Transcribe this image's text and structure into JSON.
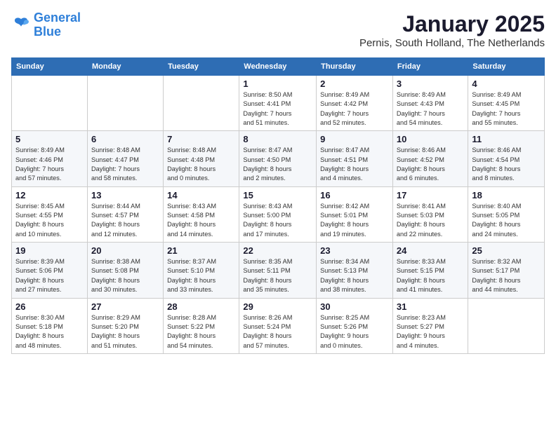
{
  "header": {
    "logo_line1": "General",
    "logo_line2": "Blue",
    "title": "January 2025",
    "subtitle": "Pernis, South Holland, The Netherlands"
  },
  "columns": [
    "Sunday",
    "Monday",
    "Tuesday",
    "Wednesday",
    "Thursday",
    "Friday",
    "Saturday"
  ],
  "weeks": [
    [
      {
        "day": "",
        "info": ""
      },
      {
        "day": "",
        "info": ""
      },
      {
        "day": "",
        "info": ""
      },
      {
        "day": "1",
        "info": "Sunrise: 8:50 AM\nSunset: 4:41 PM\nDaylight: 7 hours\nand 51 minutes."
      },
      {
        "day": "2",
        "info": "Sunrise: 8:49 AM\nSunset: 4:42 PM\nDaylight: 7 hours\nand 52 minutes."
      },
      {
        "day": "3",
        "info": "Sunrise: 8:49 AM\nSunset: 4:43 PM\nDaylight: 7 hours\nand 54 minutes."
      },
      {
        "day": "4",
        "info": "Sunrise: 8:49 AM\nSunset: 4:45 PM\nDaylight: 7 hours\nand 55 minutes."
      }
    ],
    [
      {
        "day": "5",
        "info": "Sunrise: 8:49 AM\nSunset: 4:46 PM\nDaylight: 7 hours\nand 57 minutes."
      },
      {
        "day": "6",
        "info": "Sunrise: 8:48 AM\nSunset: 4:47 PM\nDaylight: 7 hours\nand 58 minutes."
      },
      {
        "day": "7",
        "info": "Sunrise: 8:48 AM\nSunset: 4:48 PM\nDaylight: 8 hours\nand 0 minutes."
      },
      {
        "day": "8",
        "info": "Sunrise: 8:47 AM\nSunset: 4:50 PM\nDaylight: 8 hours\nand 2 minutes."
      },
      {
        "day": "9",
        "info": "Sunrise: 8:47 AM\nSunset: 4:51 PM\nDaylight: 8 hours\nand 4 minutes."
      },
      {
        "day": "10",
        "info": "Sunrise: 8:46 AM\nSunset: 4:52 PM\nDaylight: 8 hours\nand 6 minutes."
      },
      {
        "day": "11",
        "info": "Sunrise: 8:46 AM\nSunset: 4:54 PM\nDaylight: 8 hours\nand 8 minutes."
      }
    ],
    [
      {
        "day": "12",
        "info": "Sunrise: 8:45 AM\nSunset: 4:55 PM\nDaylight: 8 hours\nand 10 minutes."
      },
      {
        "day": "13",
        "info": "Sunrise: 8:44 AM\nSunset: 4:57 PM\nDaylight: 8 hours\nand 12 minutes."
      },
      {
        "day": "14",
        "info": "Sunrise: 8:43 AM\nSunset: 4:58 PM\nDaylight: 8 hours\nand 14 minutes."
      },
      {
        "day": "15",
        "info": "Sunrise: 8:43 AM\nSunset: 5:00 PM\nDaylight: 8 hours\nand 17 minutes."
      },
      {
        "day": "16",
        "info": "Sunrise: 8:42 AM\nSunset: 5:01 PM\nDaylight: 8 hours\nand 19 minutes."
      },
      {
        "day": "17",
        "info": "Sunrise: 8:41 AM\nSunset: 5:03 PM\nDaylight: 8 hours\nand 22 minutes."
      },
      {
        "day": "18",
        "info": "Sunrise: 8:40 AM\nSunset: 5:05 PM\nDaylight: 8 hours\nand 24 minutes."
      }
    ],
    [
      {
        "day": "19",
        "info": "Sunrise: 8:39 AM\nSunset: 5:06 PM\nDaylight: 8 hours\nand 27 minutes."
      },
      {
        "day": "20",
        "info": "Sunrise: 8:38 AM\nSunset: 5:08 PM\nDaylight: 8 hours\nand 30 minutes."
      },
      {
        "day": "21",
        "info": "Sunrise: 8:37 AM\nSunset: 5:10 PM\nDaylight: 8 hours\nand 33 minutes."
      },
      {
        "day": "22",
        "info": "Sunrise: 8:35 AM\nSunset: 5:11 PM\nDaylight: 8 hours\nand 35 minutes."
      },
      {
        "day": "23",
        "info": "Sunrise: 8:34 AM\nSunset: 5:13 PM\nDaylight: 8 hours\nand 38 minutes."
      },
      {
        "day": "24",
        "info": "Sunrise: 8:33 AM\nSunset: 5:15 PM\nDaylight: 8 hours\nand 41 minutes."
      },
      {
        "day": "25",
        "info": "Sunrise: 8:32 AM\nSunset: 5:17 PM\nDaylight: 8 hours\nand 44 minutes."
      }
    ],
    [
      {
        "day": "26",
        "info": "Sunrise: 8:30 AM\nSunset: 5:18 PM\nDaylight: 8 hours\nand 48 minutes."
      },
      {
        "day": "27",
        "info": "Sunrise: 8:29 AM\nSunset: 5:20 PM\nDaylight: 8 hours\nand 51 minutes."
      },
      {
        "day": "28",
        "info": "Sunrise: 8:28 AM\nSunset: 5:22 PM\nDaylight: 8 hours\nand 54 minutes."
      },
      {
        "day": "29",
        "info": "Sunrise: 8:26 AM\nSunset: 5:24 PM\nDaylight: 8 hours\nand 57 minutes."
      },
      {
        "day": "30",
        "info": "Sunrise: 8:25 AM\nSunset: 5:26 PM\nDaylight: 9 hours\nand 0 minutes."
      },
      {
        "day": "31",
        "info": "Sunrise: 8:23 AM\nSunset: 5:27 PM\nDaylight: 9 hours\nand 4 minutes."
      },
      {
        "day": "",
        "info": ""
      }
    ]
  ]
}
